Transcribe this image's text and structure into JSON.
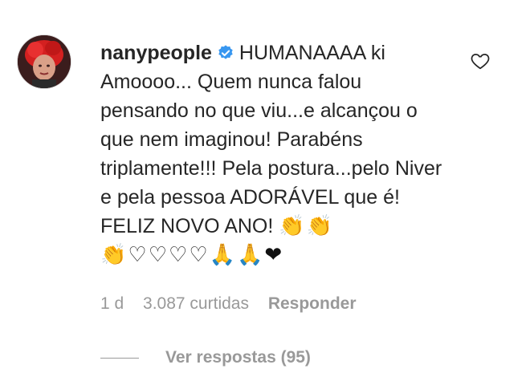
{
  "comment": {
    "username": "nanypeople",
    "text": "HUMANAAAA ki Amoooo... Quem nunca falou pensando no que viu...e alcançou o que nem imaginou! Parabéns triplamente!!! Pela postura...pelo Niver e pela pessoa ADORÁVEL que é! FELIZ NOVO ANO!",
    "emojis": [
      "👏",
      "👏",
      "👏",
      "♡",
      "♡",
      "♡",
      "♡",
      "🙏",
      "🙏",
      "❤"
    ]
  },
  "meta": {
    "time": "1 d",
    "likes": "3.087 curtidas",
    "reply_label": "Responder"
  },
  "replies": {
    "label": "Ver respostas (95)"
  },
  "icons": {
    "verified": "verified-badge-icon",
    "like": "heart-outline-icon"
  },
  "colors": {
    "verified": "#3897f0",
    "meta": "#999999",
    "text": "#262626"
  }
}
